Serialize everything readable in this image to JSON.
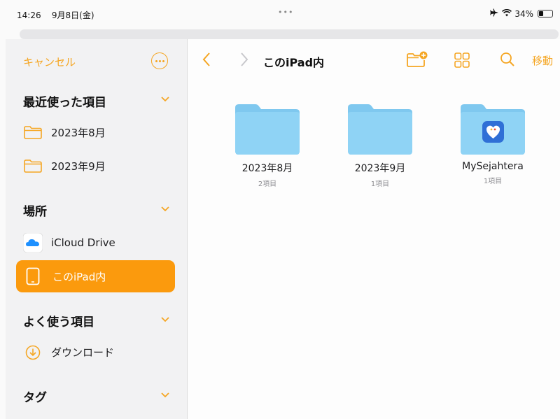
{
  "status": {
    "time": "14:26",
    "date": "9月8日(金)",
    "battery": "34%",
    "battery_level": 0.34
  },
  "sidebar": {
    "cancel_label": "キャンセル",
    "sections": {
      "recent": {
        "title": "最近使った項目",
        "items": [
          {
            "label": "2023年8月",
            "icon": "folder-outline-icon"
          },
          {
            "label": "2023年9月",
            "icon": "folder-outline-icon"
          }
        ]
      },
      "locations": {
        "title": "場所",
        "items": [
          {
            "label": "iCloud Drive",
            "icon": "icloud-icon"
          },
          {
            "label": "このiPad内",
            "icon": "ipad-icon",
            "selected": true
          }
        ]
      },
      "favorites": {
        "title": "よく使う項目",
        "items": [
          {
            "label": "ダウンロード",
            "icon": "download-icon"
          }
        ]
      },
      "tags": {
        "title": "タグ"
      }
    }
  },
  "toolbar": {
    "title": "このiPad内",
    "move_label": "移動"
  },
  "folders": [
    {
      "name": "2023年8月",
      "count": "2項目"
    },
    {
      "name": "2023年9月",
      "count": "1項目"
    },
    {
      "name": "MySejahtera",
      "count": "1項目"
    }
  ],
  "colors": {
    "accent": "#f5a623",
    "selected_bg": "#fb9a0d",
    "folder": "#8fd3f5"
  }
}
